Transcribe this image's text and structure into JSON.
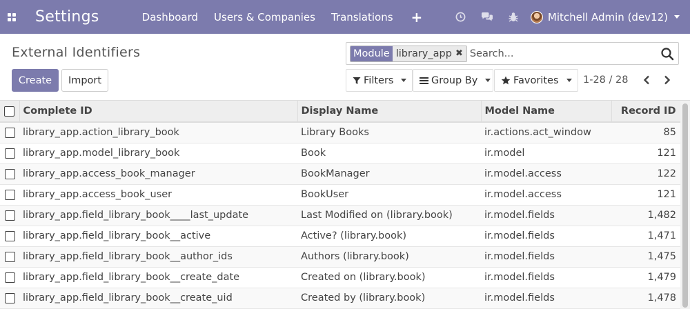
{
  "navbar": {
    "brand": "Settings",
    "menu": [
      "Dashboard",
      "Users & Companies",
      "Translations"
    ],
    "plus": "+",
    "user": "Mitchell Admin (dev12)",
    "accent": "#7c7bad"
  },
  "page": {
    "title": "External Identifiers",
    "create_label": "Create",
    "import_label": "Import"
  },
  "search": {
    "facet_label": "Module",
    "facet_value": "library_app",
    "facet_remove": "✖",
    "placeholder": "Search..."
  },
  "filters": {
    "filters_label": "Filters",
    "groupby_label": "Group By",
    "favorites_label": "Favorites",
    "pager": "1-28 / 28"
  },
  "table": {
    "columns": [
      "Complete ID",
      "Display Name",
      "Model Name",
      "Record ID"
    ],
    "rows": [
      [
        "library_app.action_library_book",
        "Library Books",
        "ir.actions.act_window",
        "85"
      ],
      [
        "library_app.model_library_book",
        "Book",
        "ir.model",
        "121"
      ],
      [
        "library_app.access_book_manager",
        "BookManager",
        "ir.model.access",
        "122"
      ],
      [
        "library_app.access_book_user",
        "BookUser",
        "ir.model.access",
        "121"
      ],
      [
        "library_app.field_library_book____last_update",
        "Last Modified on (library.book)",
        "ir.model.fields",
        "1,482"
      ],
      [
        "library_app.field_library_book__active",
        "Active? (library.book)",
        "ir.model.fields",
        "1,471"
      ],
      [
        "library_app.field_library_book__author_ids",
        "Authors (library.book)",
        "ir.model.fields",
        "1,475"
      ],
      [
        "library_app.field_library_book__create_date",
        "Created on (library.book)",
        "ir.model.fields",
        "1,479"
      ],
      [
        "library_app.field_library_book__create_uid",
        "Created by (library.book)",
        "ir.model.fields",
        "1,478"
      ]
    ]
  }
}
